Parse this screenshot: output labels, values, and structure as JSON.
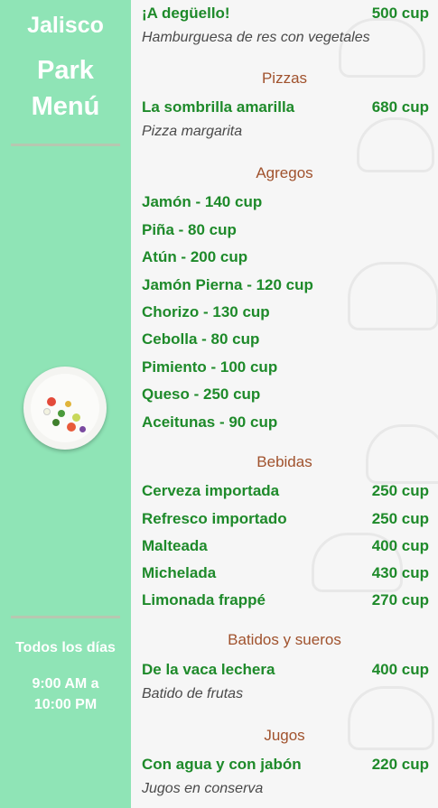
{
  "sidebar": {
    "brand_line1": "Jalisco",
    "brand_line2": "Park",
    "brand_line3": "Menú",
    "schedule_days": "Todos los días",
    "hours_line1": "9:00 AM a",
    "hours_line2": "10:00 PM"
  },
  "menu": {
    "top_item": {
      "name": "¡A degüello!",
      "price": "500 cup",
      "desc": "Hamburguesa de res con vegetales"
    },
    "pizzas": {
      "title": "Pizzas",
      "name": "La sombrilla amarilla",
      "price": "680 cup",
      "desc": "Pizza margarita"
    },
    "agregos": {
      "title": "Agregos",
      "items": [
        "Jamón - 140 cup",
        "Piña - 80 cup",
        "Atún - 200 cup",
        "Jamón Pierna - 120 cup",
        "Chorizo - 130 cup",
        "Cebolla - 80 cup",
        "Pimiento - 100 cup",
        "Queso - 250 cup",
        "Aceitunas - 90 cup"
      ]
    },
    "bebidas": {
      "title": "Bebidas",
      "items": [
        {
          "name": "Cerveza importada",
          "price": "250 cup"
        },
        {
          "name": "Refresco importado",
          "price": "250 cup"
        },
        {
          "name": "Malteada",
          "price": "400 cup"
        },
        {
          "name": "Michelada",
          "price": "430 cup"
        },
        {
          "name": "Limonada frappé",
          "price": "270 cup"
        }
      ]
    },
    "batidos": {
      "title": "Batidos y sueros",
      "name": "De la vaca lechera",
      "price": "400 cup",
      "desc": "Batido de frutas"
    },
    "jugos": {
      "title": "Jugos",
      "name": "Con agua y con jabón",
      "price": "220 cup",
      "desc": "Jugos en conserva"
    }
  },
  "colors": {
    "sidebar": "#8fe4b6",
    "item_text": "#1e8a2a",
    "section_title": "#a0522d"
  },
  "icons": {
    "plate": "food-plate-image"
  }
}
